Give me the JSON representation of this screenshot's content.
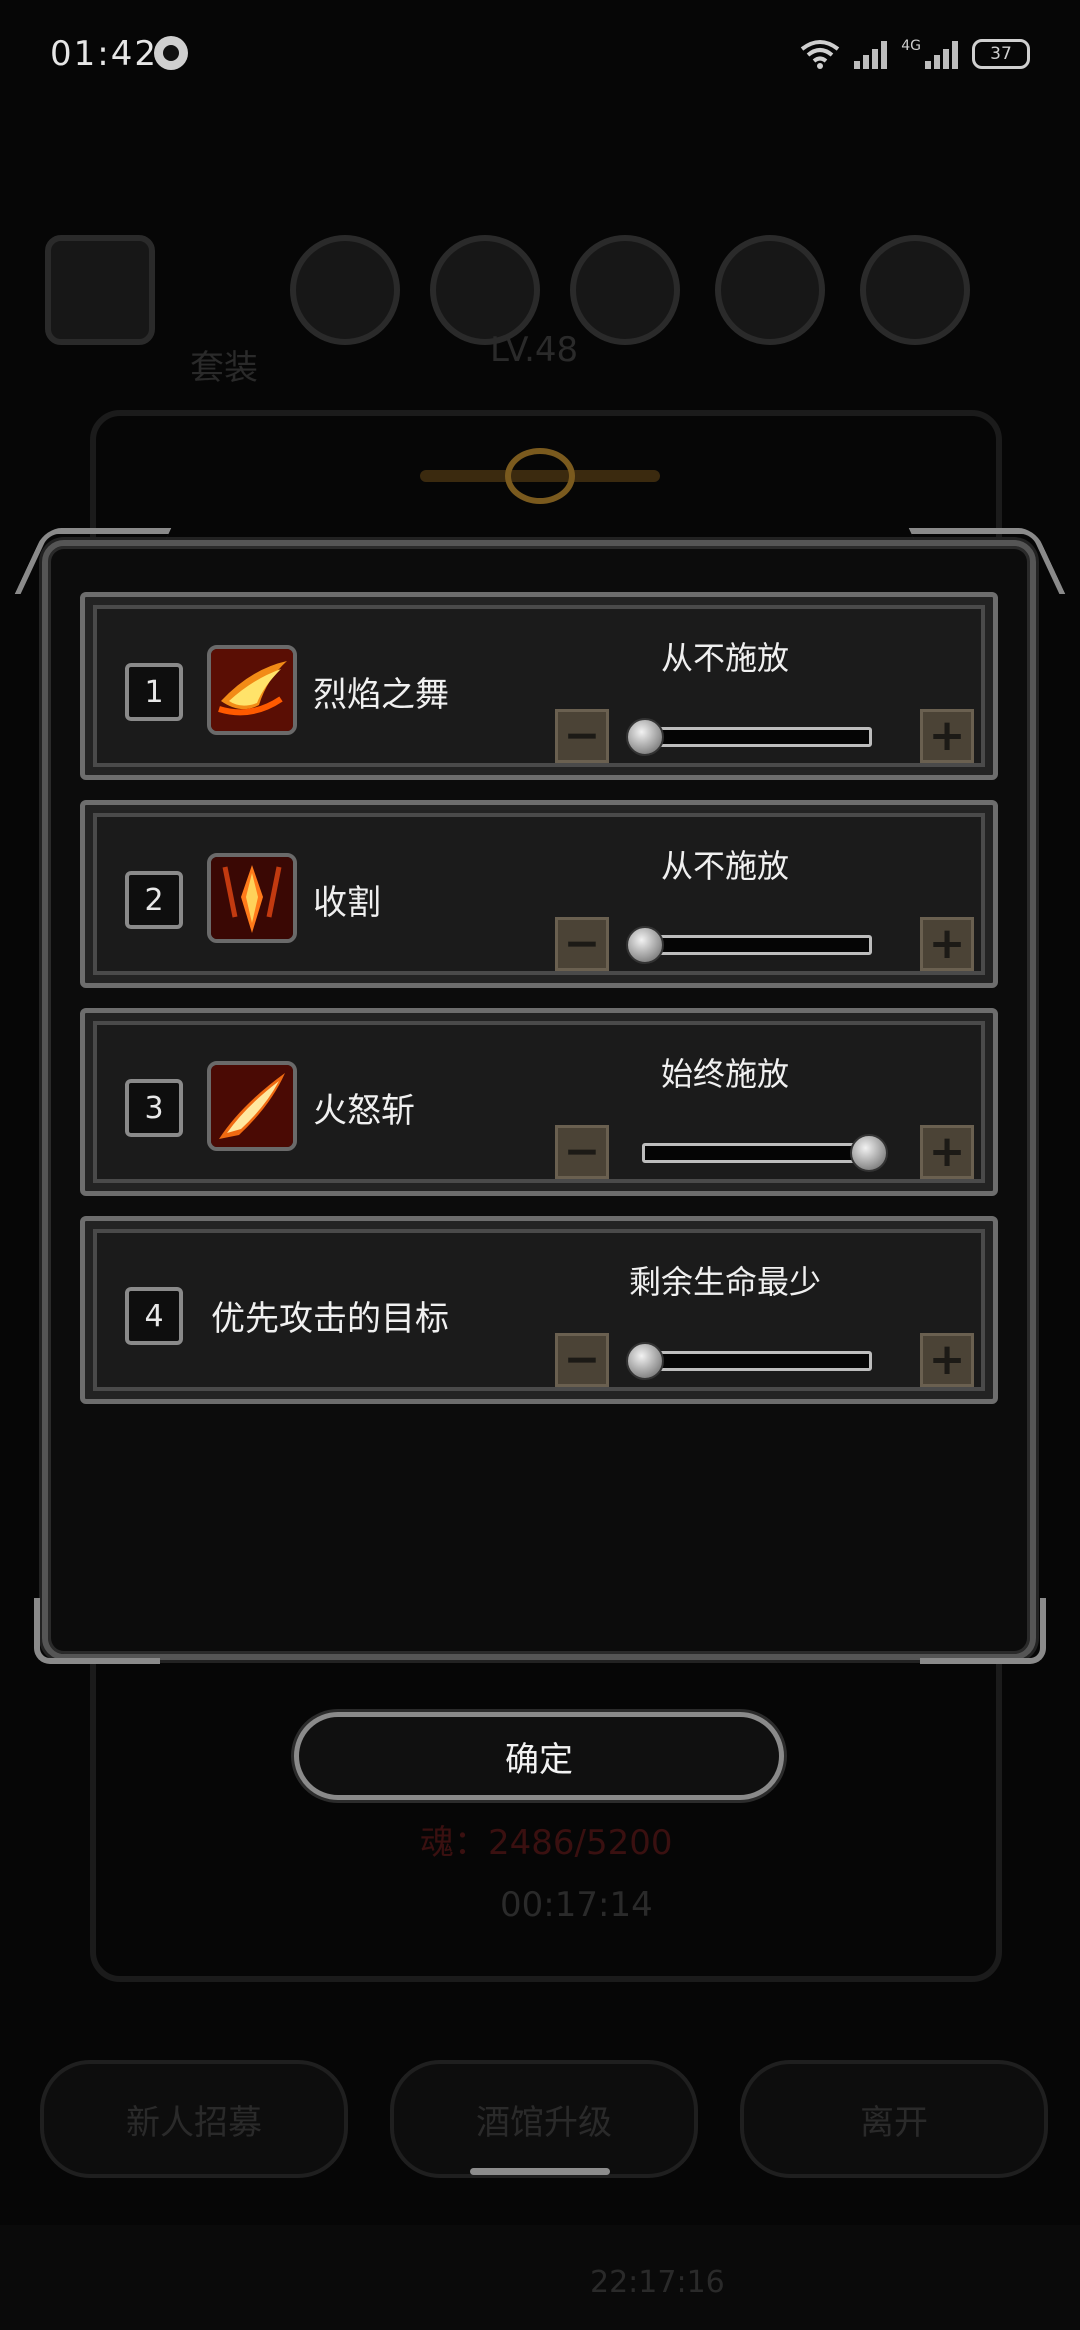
{
  "status_bar": {
    "time": "01:42",
    "network": "4G",
    "battery": "37"
  },
  "background": {
    "tab_label": "套装",
    "level": "LV.48",
    "red_resource": "魂：2486/5200",
    "timer": "00:17:14",
    "buttons": [
      "新人招募",
      "酒馆升级",
      "离开"
    ],
    "bottom_timer": "22:17:16"
  },
  "rows": [
    {
      "index": "1",
      "name": "烈焰之舞",
      "icon": "flame-dance-icon",
      "mode": "从不施放",
      "level": 0
    },
    {
      "index": "2",
      "name": "收割",
      "icon": "harvest-icon",
      "mode": "从不施放",
      "level": 0
    },
    {
      "index": "3",
      "name": "火怒斩",
      "icon": "fire-rage-slash-icon",
      "mode": "始终施放",
      "level": 1
    },
    {
      "index": "4",
      "name": "优先攻击的目标",
      "icon": null,
      "mode": "剩余生命最少",
      "level": 0
    }
  ],
  "confirm_label": "确定",
  "colors": {
    "accent": "#4b4336",
    "background": "#060606",
    "panel": "#1b1b1b"
  }
}
